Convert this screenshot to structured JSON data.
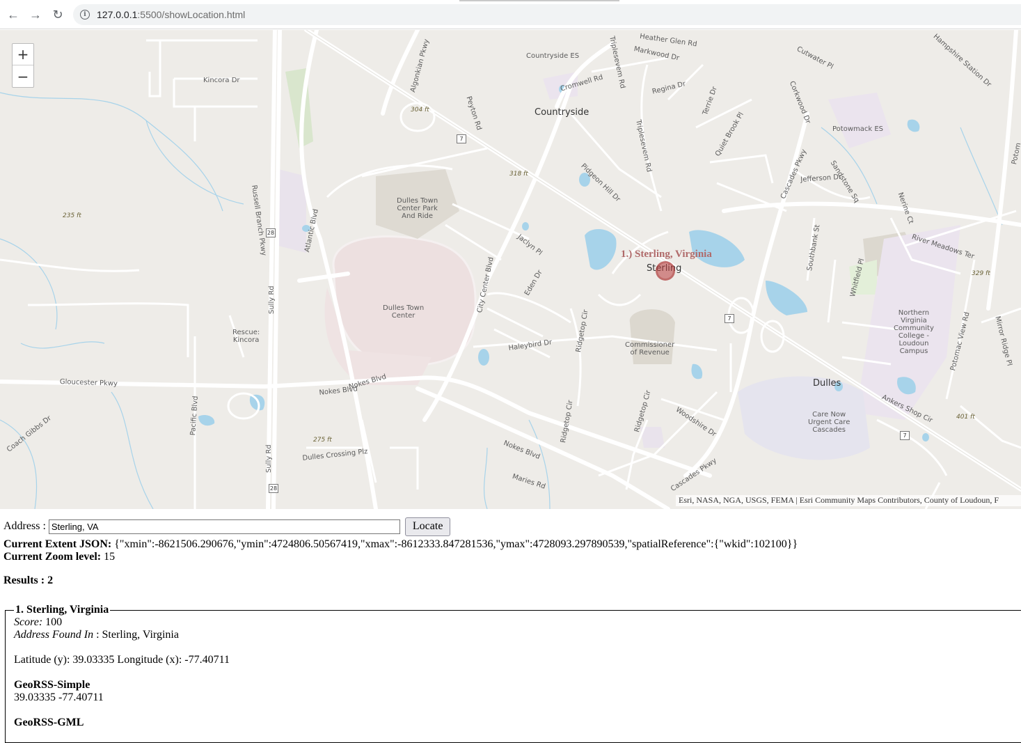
{
  "browser": {
    "url_host": "127.0.0.1",
    "url_path": ":5500/showLocation.html"
  },
  "map": {
    "zoom_in_label": "+",
    "zoom_out_label": "−",
    "result_label": "1.) Sterling, Virginia",
    "attribution": "Esri, NASA, NGA, USGS, FEMA | Esri Community Maps Contributors, County of Loudoun, F",
    "labels": {
      "heather_glen": "Heather Glen Rd",
      "countryside_es": "Countryside ES",
      "markwood": "Markwood Dr",
      "cutwater": "Cutwater Pl",
      "hampshire": "Hampshire Station Dr",
      "kincora": "Kincora Dr",
      "algonkian": "Algonkian Pkwy",
      "cromwell": "Cromwell Rd",
      "regina": "Regina Dr",
      "triple_n": "Triplesevem Rd",
      "terrie": "Terrie Dr",
      "corkwood": "Corkwood Dr",
      "potomack_es": "Potowmack ES",
      "elev304": "304 ft",
      "peyton": "Peyton Rd",
      "countryside": "Countryside",
      "quiet_brook": "Quiet Brook Pl",
      "cascades_pkwy": "Cascades Pkwy",
      "sandstone": "Sandstone Sq",
      "elev318": "318 ft",
      "pidgeon": "Pidgeon Hill Dr",
      "triple_s": "Triplesevem Rd",
      "jefferson": "Jefferson Dr",
      "nerine": "Nerine Ct",
      "dulles_park": "Dulles Town\nCenter Park\nAnd Ride",
      "russell": "Russell Branch Pkwy",
      "elev235": "235 ft",
      "atlantic": "Atlantic Blvd",
      "jaclyn": "Jaclyn Pl",
      "southbank": "Southbank St",
      "whitfield": "Whitfield Pl",
      "river_meadows": "River Meadows Ter",
      "sterling": "Sterling",
      "elev329": "329 ft",
      "city_center": "City Center Blvd",
      "eden": "Eden Dr",
      "sully_rd": "Sully Rd",
      "dulles_town_center": "Dulles Town\nCenter",
      "ridgetop_cir": "Ridgetop Cir",
      "nova": "Northern\nVirginia\nCommunity\nCollege -\nLoudoun\nCampus",
      "potomac_view": "Potomac View Rd",
      "mirror_ridge": "Mirror Ridge Pl",
      "rescue": "Rescue:\nKincora",
      "haleybird": "Haleybird Dr",
      "commissioner": "Commissioner\nof Revenue",
      "gloucester": "Gloucester Pkwy",
      "nokes1": "Nokes Blvd",
      "nokes_blvd2": "Nokes Blvd",
      "dulles": "Dulles",
      "ankers": "Ankers Shop Cir",
      "coach_gibbs": "Coach Gibbs Dr",
      "pacific": "Pacific Blvd",
      "ridgetop2": "Ridgetop Cir",
      "ridgetop3": "Ridgetop Cir",
      "woodshire": "Woodshire Dr",
      "care_now": "Care Now\nUrgent Care\nCascades",
      "elev401": "401 ft",
      "elev275": "275 ft",
      "dulles_crossing": "Dulles Crossing Plz",
      "sully_rd2": "Sully Rd",
      "cascades_pkwy2": "Cascades Pkwy",
      "maries": "Maries Rd",
      "nokes3": "Nokes Blvd",
      "potom": "Potom"
    },
    "shields": [
      "7",
      "28",
      "28",
      "7",
      "7"
    ]
  },
  "form": {
    "address_label": "Address :",
    "address_value": "Sterling, VA",
    "locate_label": "Locate"
  },
  "info": {
    "extent_label": "Current Extent JSON:",
    "extent_value": "{\"xmin\":-8621506.290676,\"ymin\":4724806.50567419,\"xmax\":-8612333.847281536,\"ymax\":4728093.297890539,\"spatialReference\":{\"wkid\":102100}}",
    "zoom_label": "Current Zoom level:",
    "zoom_value": "15",
    "results_label": "Results : 2"
  },
  "result": {
    "legend": "1. Sterling, Virginia",
    "score_label": "Score:",
    "score_value": "100",
    "found_label": "Address Found In",
    "found_value": ": Sterling, Virginia",
    "latlon": "Latitude (y): 39.03335 Longitude (x): -77.40711",
    "georss_simple_label": "GeoRSS-Simple",
    "georss_simple_value": "39.03335 -77.40711",
    "georss_gml_label": "GeoRSS-GML"
  }
}
